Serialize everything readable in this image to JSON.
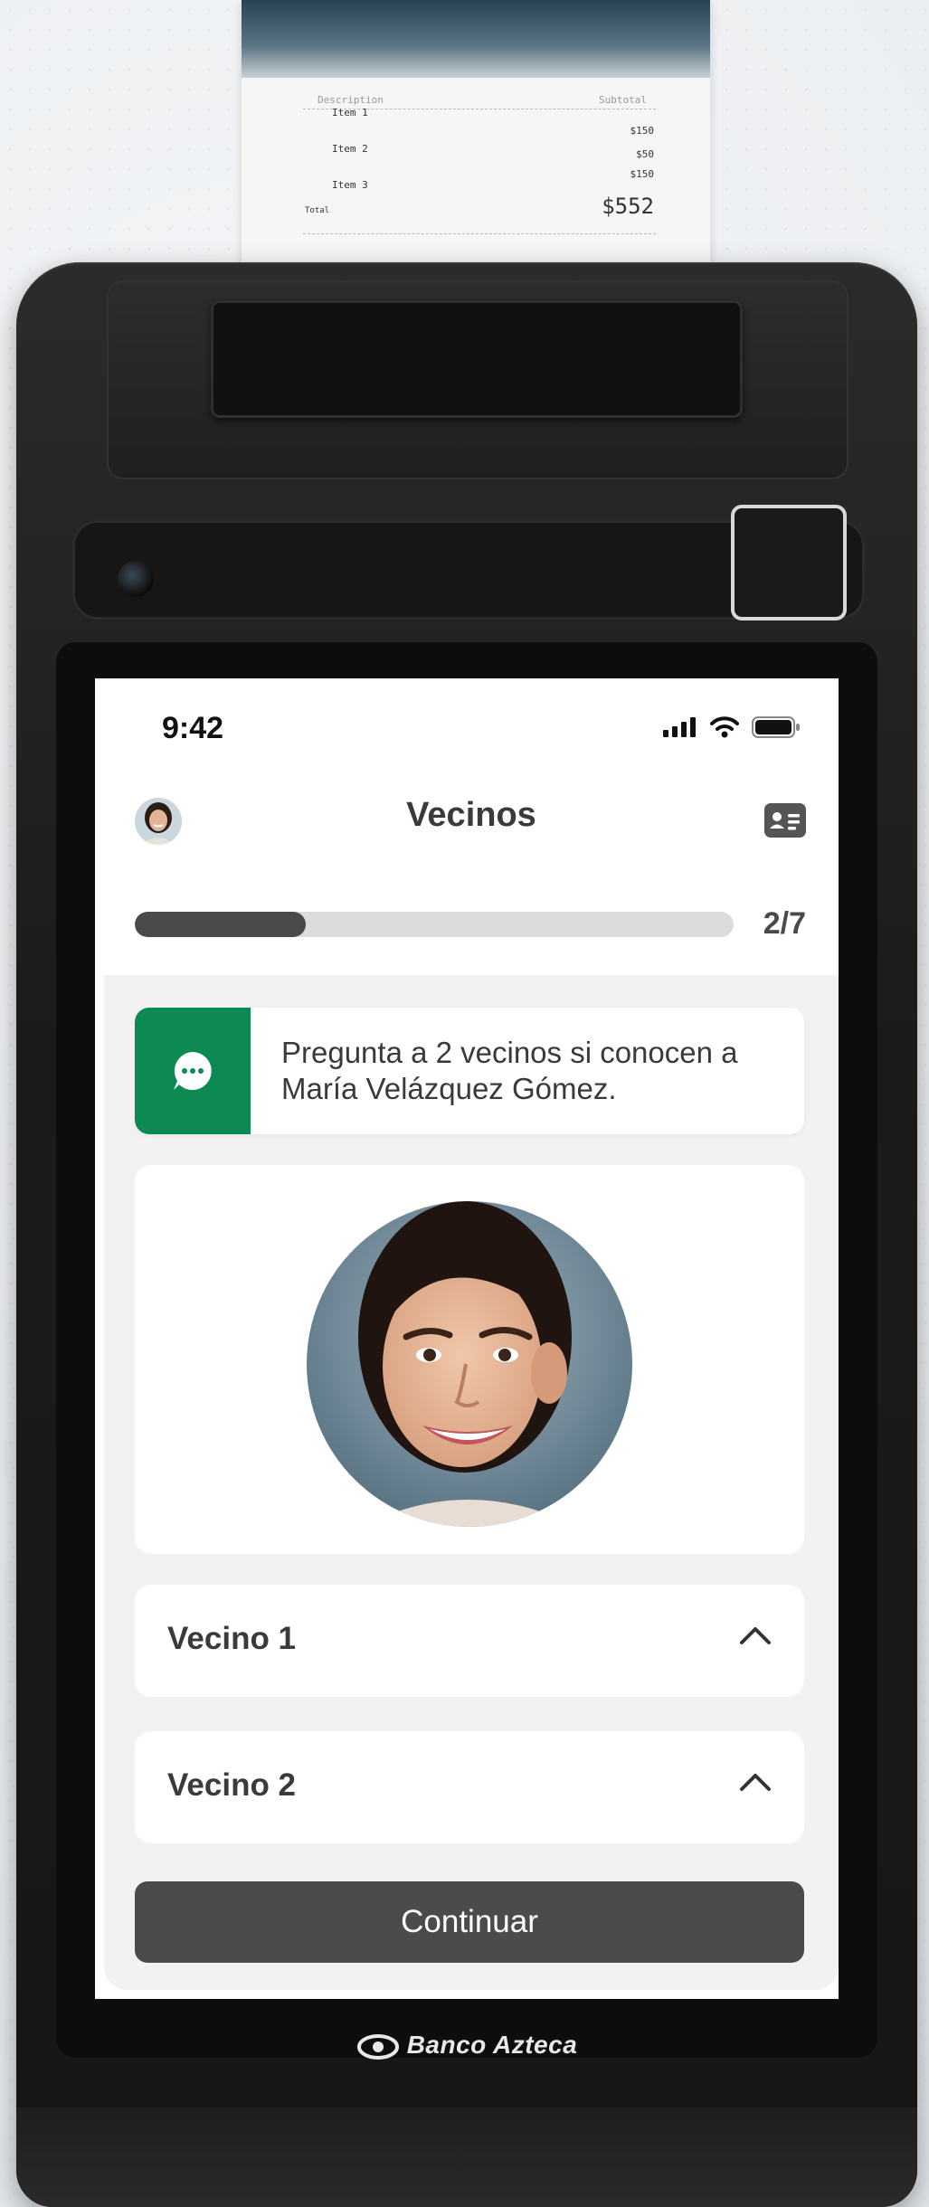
{
  "receipt": {
    "col_description": "Description",
    "col_subtotal": "Subtotal",
    "items": [
      {
        "label": "Item 1",
        "price": "$150"
      },
      {
        "label": "Item 2",
        "price": "$50"
      },
      {
        "label": "Item 3",
        "price": "$150"
      }
    ],
    "total_label": "Total",
    "total_value": "$552"
  },
  "status_bar": {
    "time": "9:42",
    "icons": [
      "signal-icon",
      "wifi-icon",
      "battery-icon"
    ]
  },
  "header": {
    "title": "Vecinos",
    "right_icon": "id-card-icon"
  },
  "progress": {
    "label": "2/7",
    "value": 0.285
  },
  "instruction": {
    "icon": "chat-bubble-icon",
    "text": "Pregunta a 2 vecinos si conocen a María Velázquez Gómez."
  },
  "accordions": [
    {
      "label": "Vecino 1",
      "state": "expanded-chevron"
    },
    {
      "label": "Vecino 2",
      "state": "expanded-chevron"
    }
  ],
  "continue_button": {
    "label": "Continuar"
  },
  "brand": {
    "name": "Banco Azteca"
  },
  "colors": {
    "accent_green": "#0d8a52",
    "button_dark": "#4b4b4b",
    "progress_fill": "#4a4a4a",
    "app_background": "#f2f2f3"
  }
}
